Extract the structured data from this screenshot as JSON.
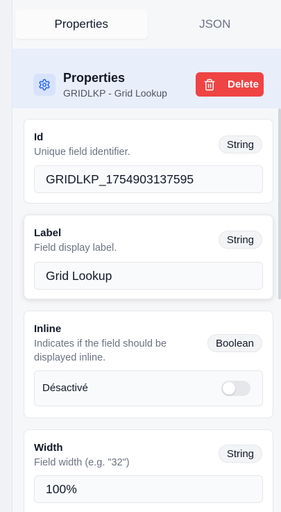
{
  "tabs": [
    {
      "label": "Properties",
      "active": true
    },
    {
      "label": "JSON",
      "active": false
    }
  ],
  "header": {
    "title": "Properties",
    "subtitle": "GRIDLKP - Grid Lookup",
    "delete_label": "Delete",
    "icon": "gear-icon",
    "accent_color": "#ef4444"
  },
  "fields": {
    "id": {
      "label": "Id",
      "description": "Unique field identifier.",
      "type": "String",
      "value": "GRIDLKP_1754903137595"
    },
    "label": {
      "label": "Label",
      "description": "Field display label.",
      "type": "String",
      "value": "Grid Lookup"
    },
    "inline": {
      "label": "Inline",
      "description": "Indicates if the field should be displayed inline.",
      "type": "Boolean",
      "toggle_label": "Désactivé",
      "toggle_on": false
    },
    "width": {
      "label": "Width",
      "description": "Field width (e.g. \"32\")",
      "type": "String",
      "value": "100%"
    }
  }
}
